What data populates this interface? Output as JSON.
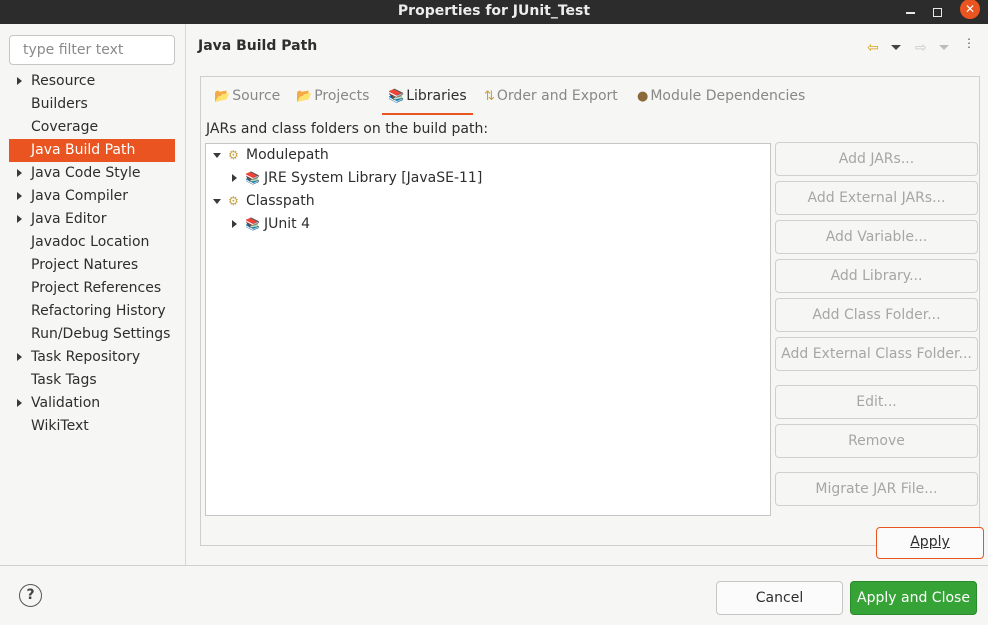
{
  "window": {
    "title": "Properties for JUnit_Test",
    "minimize_glyph": "",
    "maximize_glyph": "",
    "close_glyph": "✕"
  },
  "sidebar": {
    "filter_placeholder": "type filter text",
    "items": [
      {
        "label": "Resource",
        "expandable": true
      },
      {
        "label": "Builders",
        "expandable": false
      },
      {
        "label": "Coverage",
        "expandable": false
      },
      {
        "label": "Java Build Path",
        "expandable": false,
        "selected": true
      },
      {
        "label": "Java Code Style",
        "expandable": true
      },
      {
        "label": "Java Compiler",
        "expandable": true
      },
      {
        "label": "Java Editor",
        "expandable": true
      },
      {
        "label": "Javadoc Location",
        "expandable": false
      },
      {
        "label": "Project Natures",
        "expandable": false
      },
      {
        "label": "Project References",
        "expandable": false
      },
      {
        "label": "Refactoring History",
        "expandable": false
      },
      {
        "label": "Run/Debug Settings",
        "expandable": false
      },
      {
        "label": "Task Repository",
        "expandable": true
      },
      {
        "label": "Task Tags",
        "expandable": false
      },
      {
        "label": "Validation",
        "expandable": true
      },
      {
        "label": "WikiText",
        "expandable": false
      }
    ]
  },
  "main": {
    "title": "Java Build Path",
    "nav": {
      "back_glyph": "⇦",
      "forward_glyph": "⇨",
      "menu_glyph": "⋮"
    },
    "tabs": [
      {
        "label": "Source",
        "icon": "source-folder-icon",
        "glyph": "📂",
        "active": false
      },
      {
        "label": "Projects",
        "icon": "projects-icon",
        "glyph": "📂",
        "active": false
      },
      {
        "label": "Libraries",
        "icon": "libraries-icon",
        "glyph": "📚",
        "active": true
      },
      {
        "label": "Order and Export",
        "icon": "order-export-icon",
        "glyph": "⇅",
        "active": false
      },
      {
        "label": "Module Dependencies",
        "icon": "module-icon",
        "glyph": "●",
        "active": false
      }
    ],
    "jars_label": "JARs and class folders on the build path:",
    "build_path_tree": [
      {
        "label": "Modulepath",
        "level": 0,
        "expanded": true,
        "icon": "modulepath-icon",
        "glyph": "⚙"
      },
      {
        "label": "JRE System Library [JavaSE-11]",
        "level": 1,
        "expanded": false,
        "icon": "library-icon",
        "glyph": "📚"
      },
      {
        "label": "Classpath",
        "level": 0,
        "expanded": true,
        "icon": "classpath-icon",
        "glyph": "⚙"
      },
      {
        "label": "JUnit 4",
        "level": 1,
        "expanded": false,
        "icon": "library-icon",
        "glyph": "📚"
      }
    ],
    "buttons": {
      "add_jars": "Add JARs...",
      "add_external_jars": "Add External JARs...",
      "add_variable": "Add Variable...",
      "add_library": "Add Library...",
      "add_class_folder": "Add Class Folder...",
      "add_external_class_folder": "Add External Class Folder...",
      "edit": "Edit...",
      "remove": "Remove",
      "migrate_jar": "Migrate JAR File..."
    },
    "apply_label": "Apply"
  },
  "footer": {
    "help_glyph": "?",
    "cancel_label": "Cancel",
    "apply_close_label": "Apply and Close"
  },
  "colors": {
    "accent": "#e95420",
    "apply_close_bg": "#36a336",
    "titlebar_bg": "#2c2c2c"
  }
}
